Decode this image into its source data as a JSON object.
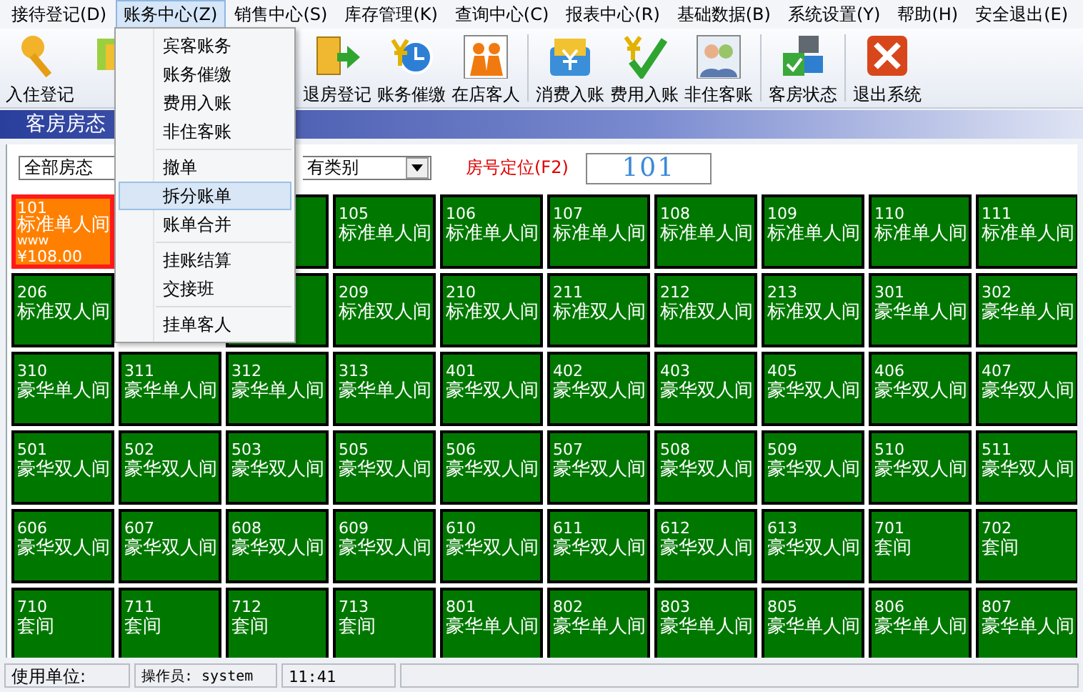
{
  "menubar": [
    {
      "label": "接待登记(D)",
      "selected": false
    },
    {
      "label": "账务中心(Z)",
      "selected": true
    },
    {
      "label": "销售中心(S)",
      "selected": false
    },
    {
      "label": "库存管理(K)",
      "selected": false
    },
    {
      "label": "查询中心(C)",
      "selected": false
    },
    {
      "label": "报表中心(R)",
      "selected": false
    },
    {
      "label": "基础数据(B)",
      "selected": false
    },
    {
      "label": "系统设置(Y)",
      "selected": false
    },
    {
      "label": "帮助(H)",
      "selected": false
    },
    {
      "label": "安全退出(E)",
      "selected": false
    }
  ],
  "toolbar": [
    {
      "kind": "key",
      "label": "入住登记"
    },
    {
      "kind": "partial"
    },
    {
      "kind": "gap"
    },
    {
      "kind": "checkout",
      "label": "退房登记"
    },
    {
      "kind": "clock",
      "label": "账务催缴"
    },
    {
      "kind": "people",
      "label": "在店客人"
    },
    {
      "kind": "separator"
    },
    {
      "kind": "card",
      "label": "消费入账"
    },
    {
      "kind": "check",
      "label": "费用入账"
    },
    {
      "kind": "guests",
      "label": "非住客账"
    },
    {
      "kind": "separator"
    },
    {
      "kind": "status",
      "label": "客房状态"
    },
    {
      "kind": "separator"
    },
    {
      "kind": "exit",
      "label": "退出系统"
    }
  ],
  "dropdown": [
    {
      "kind": "item",
      "label": "宾客账务",
      "selected": false
    },
    {
      "kind": "item",
      "label": "账务催缴",
      "selected": false
    },
    {
      "kind": "item",
      "label": "费用入账",
      "selected": false
    },
    {
      "kind": "item",
      "label": "非住客账",
      "selected": false
    },
    {
      "kind": "separator"
    },
    {
      "kind": "item",
      "label": "撤单",
      "selected": false
    },
    {
      "kind": "item",
      "label": "拆分账单",
      "selected": true
    },
    {
      "kind": "item",
      "label": "账单合并",
      "selected": false
    },
    {
      "kind": "separator"
    },
    {
      "kind": "item",
      "label": "挂账结算",
      "selected": false
    },
    {
      "kind": "item",
      "label": "交接班",
      "selected": false
    },
    {
      "kind": "separator"
    },
    {
      "kind": "item",
      "label": "挂单客人",
      "selected": false
    }
  ],
  "panel_title": "客房房态",
  "filters": {
    "status_select": "全部房态",
    "type_select": "有类别",
    "locate_label": "房号定位(F2)",
    "locate_value": "101"
  },
  "rooms": [
    {
      "kind": "room",
      "number": "101",
      "type": "标准单人间",
      "guest": "www",
      "price": "¥108.00",
      "color": "#ff8000",
      "selected": true
    },
    {
      "kind": "hidden"
    },
    {
      "kind": "covered",
      "color": "#007800"
    },
    {
      "kind": "room",
      "number": "105",
      "type": "标准单人间",
      "color": "#007800",
      "selected": false
    },
    {
      "kind": "room",
      "number": "106",
      "type": "标准单人间",
      "color": "#007800",
      "selected": false
    },
    {
      "kind": "room",
      "number": "107",
      "type": "标准单人间",
      "color": "#007800",
      "selected": false
    },
    {
      "kind": "room",
      "number": "108",
      "type": "标准单人间",
      "color": "#007800",
      "selected": false
    },
    {
      "kind": "room",
      "number": "109",
      "type": "标准单人间",
      "color": "#007800",
      "selected": false
    },
    {
      "kind": "room",
      "number": "110",
      "type": "标准单人间",
      "color": "#007800",
      "selected": false
    },
    {
      "kind": "room",
      "number": "111",
      "type": "标准单人间",
      "color": "#007800",
      "selected": false
    },
    {
      "kind": "room",
      "number": "206",
      "type": "标准双人间",
      "color": "#007800",
      "selected": false
    },
    {
      "kind": "hidden"
    },
    {
      "kind": "covered",
      "color": "#007800"
    },
    {
      "kind": "room",
      "number": "209",
      "type": "标准双人间",
      "color": "#007800",
      "selected": false
    },
    {
      "kind": "room",
      "number": "210",
      "type": "标准双人间",
      "color": "#007800",
      "selected": false
    },
    {
      "kind": "room",
      "number": "211",
      "type": "标准双人间",
      "color": "#007800",
      "selected": false
    },
    {
      "kind": "room",
      "number": "212",
      "type": "标准双人间",
      "color": "#007800",
      "selected": false
    },
    {
      "kind": "room",
      "number": "213",
      "type": "标准双人间",
      "color": "#007800",
      "selected": false
    },
    {
      "kind": "room",
      "number": "301",
      "type": "豪华单人间",
      "color": "#007800",
      "selected": false
    },
    {
      "kind": "room",
      "number": "302",
      "type": "豪华单人间",
      "color": "#007800",
      "selected": false
    },
    {
      "kind": "room",
      "number": "310",
      "type": "豪华单人间",
      "color": "#007800",
      "selected": false
    },
    {
      "kind": "room",
      "number": "311",
      "type": "豪华单人间",
      "color": "#007800",
      "selected": false
    },
    {
      "kind": "room",
      "number": "312",
      "type": "豪华单人间",
      "color": "#007800",
      "selected": false
    },
    {
      "kind": "room",
      "number": "313",
      "type": "豪华单人间",
      "color": "#007800",
      "selected": false
    },
    {
      "kind": "room",
      "number": "401",
      "type": "豪华双人间",
      "color": "#007800",
      "selected": false
    },
    {
      "kind": "room",
      "number": "402",
      "type": "豪华双人间",
      "color": "#007800",
      "selected": false
    },
    {
      "kind": "room",
      "number": "403",
      "type": "豪华双人间",
      "color": "#007800",
      "selected": false
    },
    {
      "kind": "room",
      "number": "405",
      "type": "豪华双人间",
      "color": "#007800",
      "selected": false
    },
    {
      "kind": "room",
      "number": "406",
      "type": "豪华双人间",
      "color": "#007800",
      "selected": false
    },
    {
      "kind": "room",
      "number": "407",
      "type": "豪华双人间",
      "color": "#007800",
      "selected": false
    },
    {
      "kind": "room",
      "number": "501",
      "type": "豪华双人间",
      "color": "#007800",
      "selected": false
    },
    {
      "kind": "room",
      "number": "502",
      "type": "豪华双人间",
      "color": "#007800",
      "selected": false
    },
    {
      "kind": "room",
      "number": "503",
      "type": "豪华双人间",
      "color": "#007800",
      "selected": false
    },
    {
      "kind": "room",
      "number": "505",
      "type": "豪华双人间",
      "color": "#007800",
      "selected": false
    },
    {
      "kind": "room",
      "number": "506",
      "type": "豪华双人间",
      "color": "#007800",
      "selected": false
    },
    {
      "kind": "room",
      "number": "507",
      "type": "豪华双人间",
      "color": "#007800",
      "selected": false
    },
    {
      "kind": "room",
      "number": "508",
      "type": "豪华双人间",
      "color": "#007800",
      "selected": false
    },
    {
      "kind": "room",
      "number": "509",
      "type": "豪华双人间",
      "color": "#007800",
      "selected": false
    },
    {
      "kind": "room",
      "number": "510",
      "type": "豪华双人间",
      "color": "#007800",
      "selected": false
    },
    {
      "kind": "room",
      "number": "511",
      "type": "豪华双人间",
      "color": "#007800",
      "selected": false
    },
    {
      "kind": "room",
      "number": "606",
      "type": "豪华双人间",
      "color": "#007800",
      "selected": false
    },
    {
      "kind": "room",
      "number": "607",
      "type": "豪华双人间",
      "color": "#007800",
      "selected": false
    },
    {
      "kind": "room",
      "number": "608",
      "type": "豪华双人间",
      "color": "#007800",
      "selected": false
    },
    {
      "kind": "room",
      "number": "609",
      "type": "豪华双人间",
      "color": "#007800",
      "selected": false
    },
    {
      "kind": "room",
      "number": "610",
      "type": "豪华双人间",
      "color": "#007800",
      "selected": false
    },
    {
      "kind": "room",
      "number": "611",
      "type": "豪华双人间",
      "color": "#007800",
      "selected": false
    },
    {
      "kind": "room",
      "number": "612",
      "type": "豪华双人间",
      "color": "#007800",
      "selected": false
    },
    {
      "kind": "room",
      "number": "613",
      "type": "豪华双人间",
      "color": "#007800",
      "selected": false
    },
    {
      "kind": "room",
      "number": "701",
      "type": "套间",
      "color": "#007800",
      "selected": false
    },
    {
      "kind": "room",
      "number": "702",
      "type": "套间",
      "color": "#007800",
      "selected": false
    },
    {
      "kind": "room",
      "number": "710",
      "type": "套间",
      "color": "#007800",
      "selected": false
    },
    {
      "kind": "room",
      "number": "711",
      "type": "套间",
      "color": "#007800",
      "selected": false
    },
    {
      "kind": "room",
      "number": "712",
      "type": "套间",
      "color": "#007800",
      "selected": false
    },
    {
      "kind": "room",
      "number": "713",
      "type": "套间",
      "color": "#007800",
      "selected": false
    },
    {
      "kind": "room",
      "number": "801",
      "type": "豪华单人间",
      "color": "#007800",
      "selected": false
    },
    {
      "kind": "room",
      "number": "802",
      "type": "豪华单人间",
      "color": "#007800",
      "selected": false
    },
    {
      "kind": "room",
      "number": "803",
      "type": "豪华单人间",
      "color": "#007800",
      "selected": false
    },
    {
      "kind": "room",
      "number": "805",
      "type": "豪华单人间",
      "color": "#007800",
      "selected": false
    },
    {
      "kind": "room",
      "number": "806",
      "type": "豪华单人间",
      "color": "#007800",
      "selected": false
    },
    {
      "kind": "room",
      "number": "807",
      "type": "豪华单人间",
      "color": "#007800",
      "selected": false
    }
  ],
  "status_bar": {
    "unit_label": "使用单位:",
    "operator": "操作员: system",
    "time": "11:41"
  }
}
